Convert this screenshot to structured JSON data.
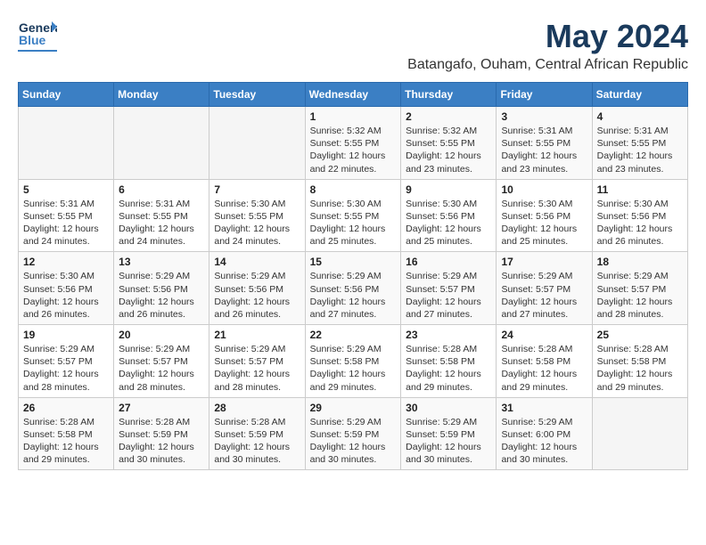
{
  "header": {
    "logo": {
      "line1": "General",
      "line2": "Blue"
    },
    "month_year": "May 2024",
    "location": "Batangafo, Ouham, Central African Republic"
  },
  "calendar": {
    "days_of_week": [
      "Sunday",
      "Monday",
      "Tuesday",
      "Wednesday",
      "Thursday",
      "Friday",
      "Saturday"
    ],
    "weeks": [
      [
        {
          "day": "",
          "info": ""
        },
        {
          "day": "",
          "info": ""
        },
        {
          "day": "",
          "info": ""
        },
        {
          "day": "1",
          "info": "Sunrise: 5:32 AM\nSunset: 5:55 PM\nDaylight: 12 hours\nand 22 minutes."
        },
        {
          "day": "2",
          "info": "Sunrise: 5:32 AM\nSunset: 5:55 PM\nDaylight: 12 hours\nand 23 minutes."
        },
        {
          "day": "3",
          "info": "Sunrise: 5:31 AM\nSunset: 5:55 PM\nDaylight: 12 hours\nand 23 minutes."
        },
        {
          "day": "4",
          "info": "Sunrise: 5:31 AM\nSunset: 5:55 PM\nDaylight: 12 hours\nand 23 minutes."
        }
      ],
      [
        {
          "day": "5",
          "info": "Sunrise: 5:31 AM\nSunset: 5:55 PM\nDaylight: 12 hours\nand 24 minutes."
        },
        {
          "day": "6",
          "info": "Sunrise: 5:31 AM\nSunset: 5:55 PM\nDaylight: 12 hours\nand 24 minutes."
        },
        {
          "day": "7",
          "info": "Sunrise: 5:30 AM\nSunset: 5:55 PM\nDaylight: 12 hours\nand 24 minutes."
        },
        {
          "day": "8",
          "info": "Sunrise: 5:30 AM\nSunset: 5:55 PM\nDaylight: 12 hours\nand 25 minutes."
        },
        {
          "day": "9",
          "info": "Sunrise: 5:30 AM\nSunset: 5:56 PM\nDaylight: 12 hours\nand 25 minutes."
        },
        {
          "day": "10",
          "info": "Sunrise: 5:30 AM\nSunset: 5:56 PM\nDaylight: 12 hours\nand 25 minutes."
        },
        {
          "day": "11",
          "info": "Sunrise: 5:30 AM\nSunset: 5:56 PM\nDaylight: 12 hours\nand 26 minutes."
        }
      ],
      [
        {
          "day": "12",
          "info": "Sunrise: 5:30 AM\nSunset: 5:56 PM\nDaylight: 12 hours\nand 26 minutes."
        },
        {
          "day": "13",
          "info": "Sunrise: 5:29 AM\nSunset: 5:56 PM\nDaylight: 12 hours\nand 26 minutes."
        },
        {
          "day": "14",
          "info": "Sunrise: 5:29 AM\nSunset: 5:56 PM\nDaylight: 12 hours\nand 26 minutes."
        },
        {
          "day": "15",
          "info": "Sunrise: 5:29 AM\nSunset: 5:56 PM\nDaylight: 12 hours\nand 27 minutes."
        },
        {
          "day": "16",
          "info": "Sunrise: 5:29 AM\nSunset: 5:57 PM\nDaylight: 12 hours\nand 27 minutes."
        },
        {
          "day": "17",
          "info": "Sunrise: 5:29 AM\nSunset: 5:57 PM\nDaylight: 12 hours\nand 27 minutes."
        },
        {
          "day": "18",
          "info": "Sunrise: 5:29 AM\nSunset: 5:57 PM\nDaylight: 12 hours\nand 28 minutes."
        }
      ],
      [
        {
          "day": "19",
          "info": "Sunrise: 5:29 AM\nSunset: 5:57 PM\nDaylight: 12 hours\nand 28 minutes."
        },
        {
          "day": "20",
          "info": "Sunrise: 5:29 AM\nSunset: 5:57 PM\nDaylight: 12 hours\nand 28 minutes."
        },
        {
          "day": "21",
          "info": "Sunrise: 5:29 AM\nSunset: 5:57 PM\nDaylight: 12 hours\nand 28 minutes."
        },
        {
          "day": "22",
          "info": "Sunrise: 5:29 AM\nSunset: 5:58 PM\nDaylight: 12 hours\nand 29 minutes."
        },
        {
          "day": "23",
          "info": "Sunrise: 5:28 AM\nSunset: 5:58 PM\nDaylight: 12 hours\nand 29 minutes."
        },
        {
          "day": "24",
          "info": "Sunrise: 5:28 AM\nSunset: 5:58 PM\nDaylight: 12 hours\nand 29 minutes."
        },
        {
          "day": "25",
          "info": "Sunrise: 5:28 AM\nSunset: 5:58 PM\nDaylight: 12 hours\nand 29 minutes."
        }
      ],
      [
        {
          "day": "26",
          "info": "Sunrise: 5:28 AM\nSunset: 5:58 PM\nDaylight: 12 hours\nand 29 minutes."
        },
        {
          "day": "27",
          "info": "Sunrise: 5:28 AM\nSunset: 5:59 PM\nDaylight: 12 hours\nand 30 minutes."
        },
        {
          "day": "28",
          "info": "Sunrise: 5:28 AM\nSunset: 5:59 PM\nDaylight: 12 hours\nand 30 minutes."
        },
        {
          "day": "29",
          "info": "Sunrise: 5:29 AM\nSunset: 5:59 PM\nDaylight: 12 hours\nand 30 minutes."
        },
        {
          "day": "30",
          "info": "Sunrise: 5:29 AM\nSunset: 5:59 PM\nDaylight: 12 hours\nand 30 minutes."
        },
        {
          "day": "31",
          "info": "Sunrise: 5:29 AM\nSunset: 6:00 PM\nDaylight: 12 hours\nand 30 minutes."
        },
        {
          "day": "",
          "info": ""
        }
      ]
    ]
  }
}
